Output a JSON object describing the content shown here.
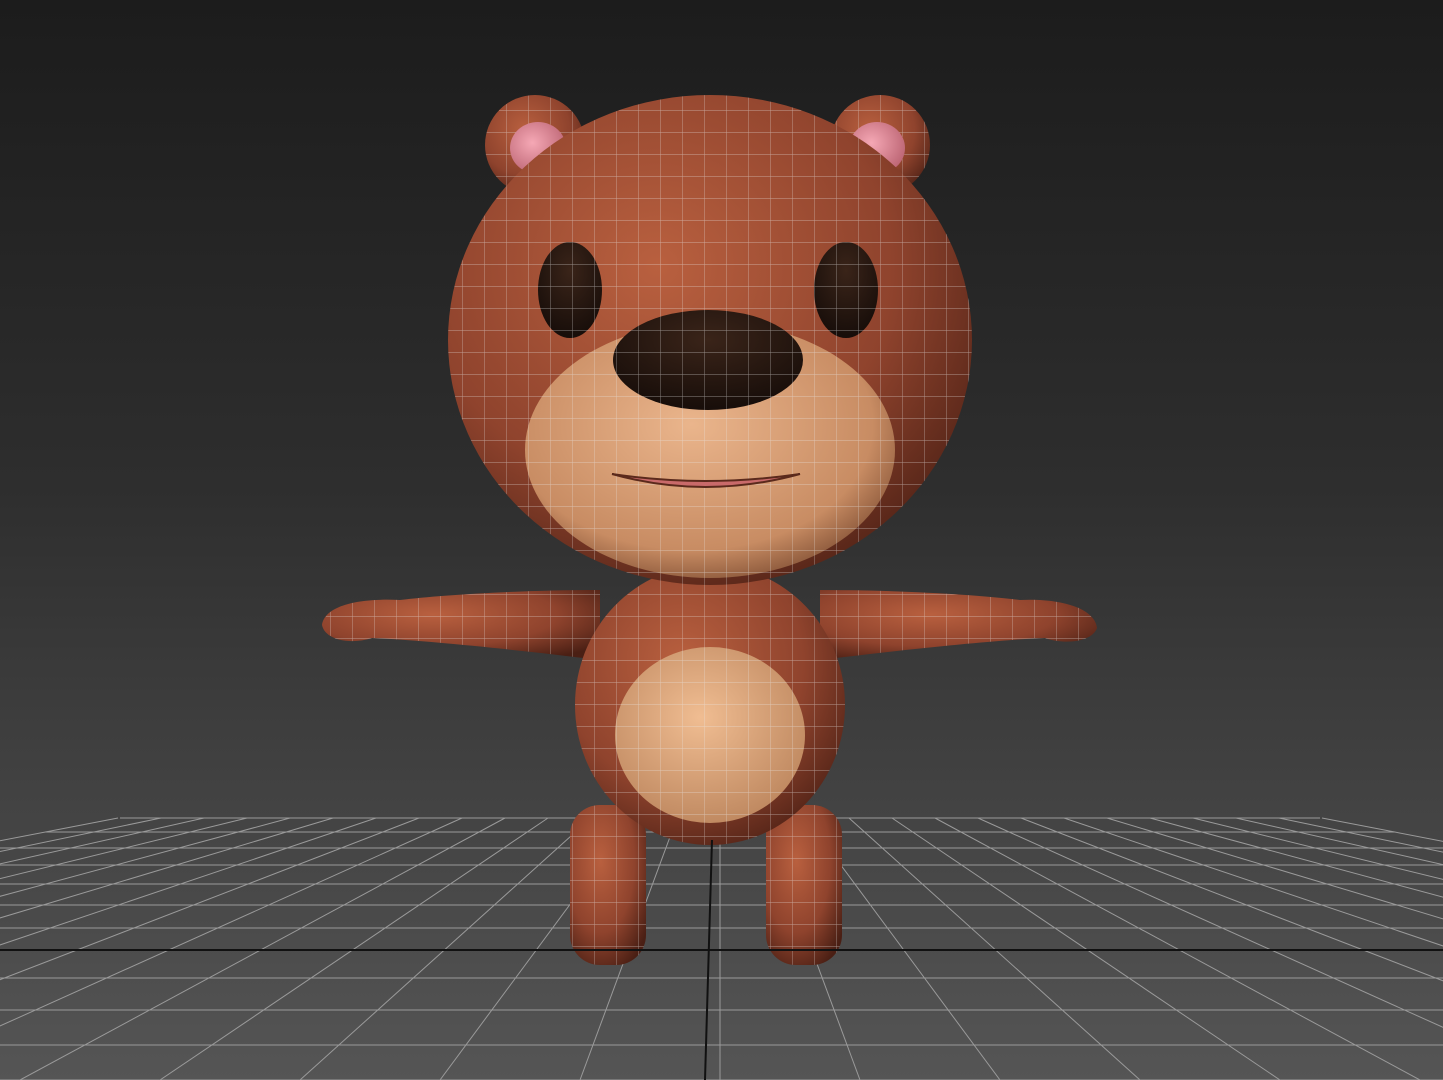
{
  "viewport": {
    "background_top": "#1c1c1c",
    "background_bottom": "#555555",
    "grid_color": "#9a9a9a",
    "axis_color": "#111111",
    "wire_color": "#e8e8e8"
  },
  "model": {
    "fur_color": "#9b4a33",
    "muzzle_color": "#e0a57a",
    "inner_ear_color": "#e58a9a",
    "eye_nose_color": "#2a1812",
    "mouth_color": "#c96a6a"
  }
}
